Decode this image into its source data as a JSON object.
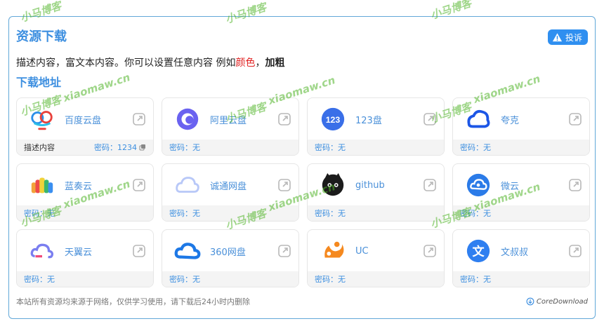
{
  "panel": {
    "title": "资源下载",
    "report_label": "投诉",
    "desc_prefix": "描述内容，富文本内容。你可以设置任意内容 例如",
    "desc_red": "颜色",
    "desc_sep": "，",
    "desc_bold": "加粗",
    "subtitle": "下载地址"
  },
  "cards": [
    {
      "name": "百度云盘",
      "icon": "baidu-cloud-icon",
      "note": "描述内容",
      "password": "密码：1234",
      "copyable": true
    },
    {
      "name": "阿里云盘",
      "icon": "aliyun-drive-icon",
      "note": "",
      "password": "密码：无"
    },
    {
      "name": "123盘",
      "icon": "pan123-icon",
      "note": "",
      "password": "密码：无"
    },
    {
      "name": "夸克",
      "icon": "quark-icon",
      "note": "",
      "password": "密码：无"
    },
    {
      "name": "蓝奏云",
      "icon": "lanzou-icon",
      "note": "",
      "password": "密码：无"
    },
    {
      "name": "诚通网盘",
      "icon": "ctfile-icon",
      "note": "",
      "password": "密码：无"
    },
    {
      "name": "github",
      "icon": "github-icon",
      "note": "",
      "password": "密码：无"
    },
    {
      "name": "微云",
      "icon": "weiyun-icon",
      "note": "",
      "password": "密码：无"
    },
    {
      "name": "天翼云",
      "icon": "tianyi-icon",
      "note": "",
      "password": "密码：无"
    },
    {
      "name": "360网盘",
      "icon": "pan360-icon",
      "note": "",
      "password": "密码：无"
    },
    {
      "name": "UC",
      "icon": "uc-icon",
      "note": "",
      "password": "密码：无"
    },
    {
      "name": "文叔叔",
      "icon": "wenshushu-icon",
      "note": "",
      "password": "密码：无"
    }
  ],
  "footer": {
    "note": "本站所有资源均来源于网络，仅供学习使用，请下载后24小时内删除",
    "brand": "CoreDownload"
  },
  "watermark": {
    "text1": "小马博客",
    "text2": "xiaomaw.cn"
  },
  "colors": {
    "accent": "#3d8fe0",
    "button": "#2f8ff0",
    "border": "#62a8d8",
    "red": "#e02020"
  }
}
